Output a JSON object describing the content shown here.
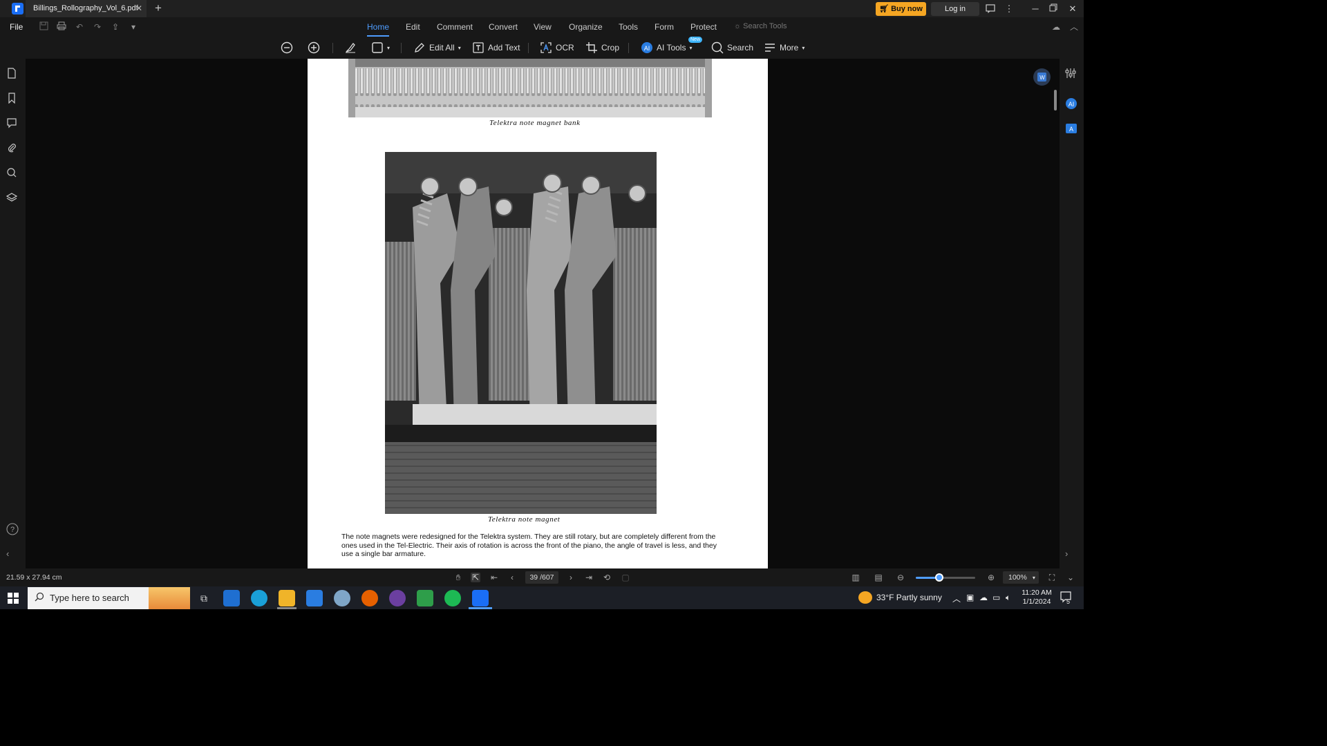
{
  "title_bar": {
    "tab_title": "Billings_Rollography_Vol_6.pdf",
    "buy_now": "Buy now",
    "log_in": "Log in"
  },
  "menu": {
    "file": "File",
    "tabs": [
      "Home",
      "Edit",
      "Comment",
      "Convert",
      "View",
      "Organize",
      "Tools",
      "Form",
      "Protect"
    ],
    "active_tab": "Home",
    "search_tools": "Search Tools"
  },
  "toolbar": {
    "edit_all": "Edit All",
    "add_text": "Add Text",
    "ocr": "OCR",
    "crop": "Crop",
    "ai_tools": "AI Tools",
    "ai_badge": "New",
    "search": "Search",
    "more": "More"
  },
  "document": {
    "caption_top": "Telektra note magnet bank",
    "caption_main": "Telektra note magnet",
    "body_text": "The note magnets were redesigned for the Telektra system.  They are still rotary, but are completely different from the ones used in the Tel-Electric.  Their axis of rotation is across the front of the piano, the angle of travel is less, and they use a single bar armature."
  },
  "status_bar": {
    "page_dimensions": "21.59 x 27.94 cm",
    "current_page": "39",
    "total_pages": "/607",
    "zoom": "100%",
    "zoom_level_fraction": 0.4
  },
  "taskbar": {
    "search_placeholder": "Type here to search",
    "weather": "33°F  Partly sunny",
    "time": "11:20 AM",
    "date": "1/1/2024",
    "notifications": "5"
  },
  "colors": {
    "accent": "#4f9dff",
    "buy_now": "#f5a623",
    "app_brand": "#1a6ef5"
  }
}
